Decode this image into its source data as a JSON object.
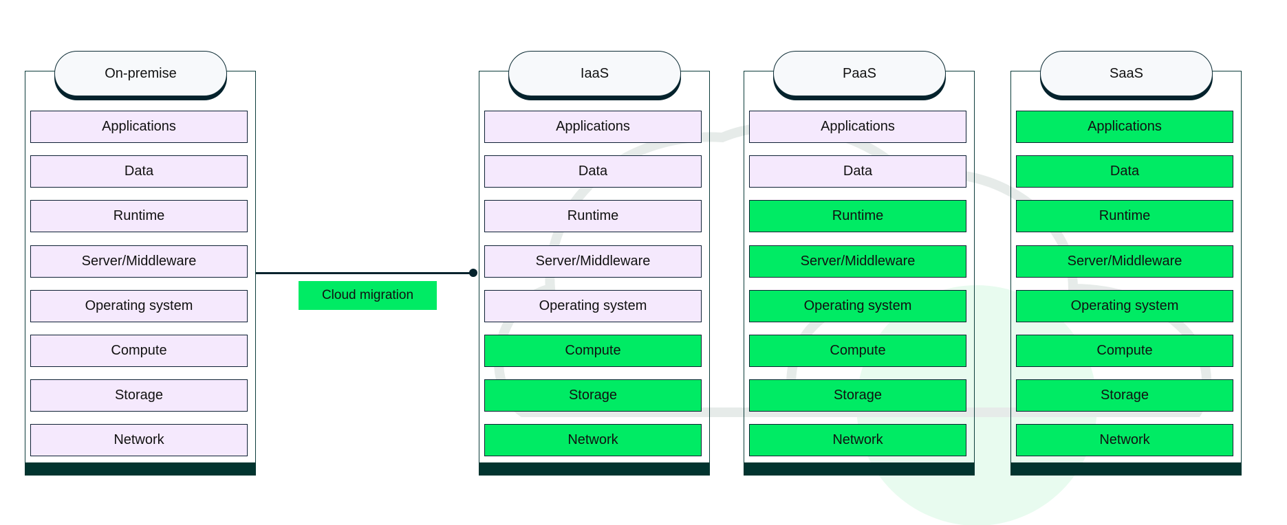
{
  "colors": {
    "customer_managed": "#f5e9fd",
    "provider_managed": "#00eb64",
    "dark": "#02342f"
  },
  "connector": {
    "label": "Cloud migration"
  },
  "columns": [
    {
      "title": "On-premise",
      "rows": [
        {
          "label": "Applications",
          "managed": "customer"
        },
        {
          "label": "Data",
          "managed": "customer"
        },
        {
          "label": "Runtime",
          "managed": "customer"
        },
        {
          "label": "Server/Middleware",
          "managed": "customer"
        },
        {
          "label": "Operating system",
          "managed": "customer"
        },
        {
          "label": "Compute",
          "managed": "customer"
        },
        {
          "label": "Storage",
          "managed": "customer"
        },
        {
          "label": "Network",
          "managed": "customer"
        }
      ]
    },
    {
      "title": "IaaS",
      "rows": [
        {
          "label": "Applications",
          "managed": "customer"
        },
        {
          "label": "Data",
          "managed": "customer"
        },
        {
          "label": "Runtime",
          "managed": "customer"
        },
        {
          "label": "Server/Middleware",
          "managed": "customer"
        },
        {
          "label": "Operating system",
          "managed": "customer"
        },
        {
          "label": "Compute",
          "managed": "provider"
        },
        {
          "label": "Storage",
          "managed": "provider"
        },
        {
          "label": "Network",
          "managed": "provider"
        }
      ]
    },
    {
      "title": "PaaS",
      "rows": [
        {
          "label": "Applications",
          "managed": "customer"
        },
        {
          "label": "Data",
          "managed": "customer"
        },
        {
          "label": "Runtime",
          "managed": "provider"
        },
        {
          "label": "Server/Middleware",
          "managed": "provider"
        },
        {
          "label": "Operating system",
          "managed": "provider"
        },
        {
          "label": "Compute",
          "managed": "provider"
        },
        {
          "label": "Storage",
          "managed": "provider"
        },
        {
          "label": "Network",
          "managed": "provider"
        }
      ]
    },
    {
      "title": "SaaS",
      "rows": [
        {
          "label": "Applications",
          "managed": "provider"
        },
        {
          "label": "Data",
          "managed": "provider"
        },
        {
          "label": "Runtime",
          "managed": "provider"
        },
        {
          "label": "Server/Middleware",
          "managed": "provider"
        },
        {
          "label": "Operating system",
          "managed": "provider"
        },
        {
          "label": "Compute",
          "managed": "provider"
        },
        {
          "label": "Storage",
          "managed": "provider"
        },
        {
          "label": "Network",
          "managed": "provider"
        }
      ]
    }
  ]
}
